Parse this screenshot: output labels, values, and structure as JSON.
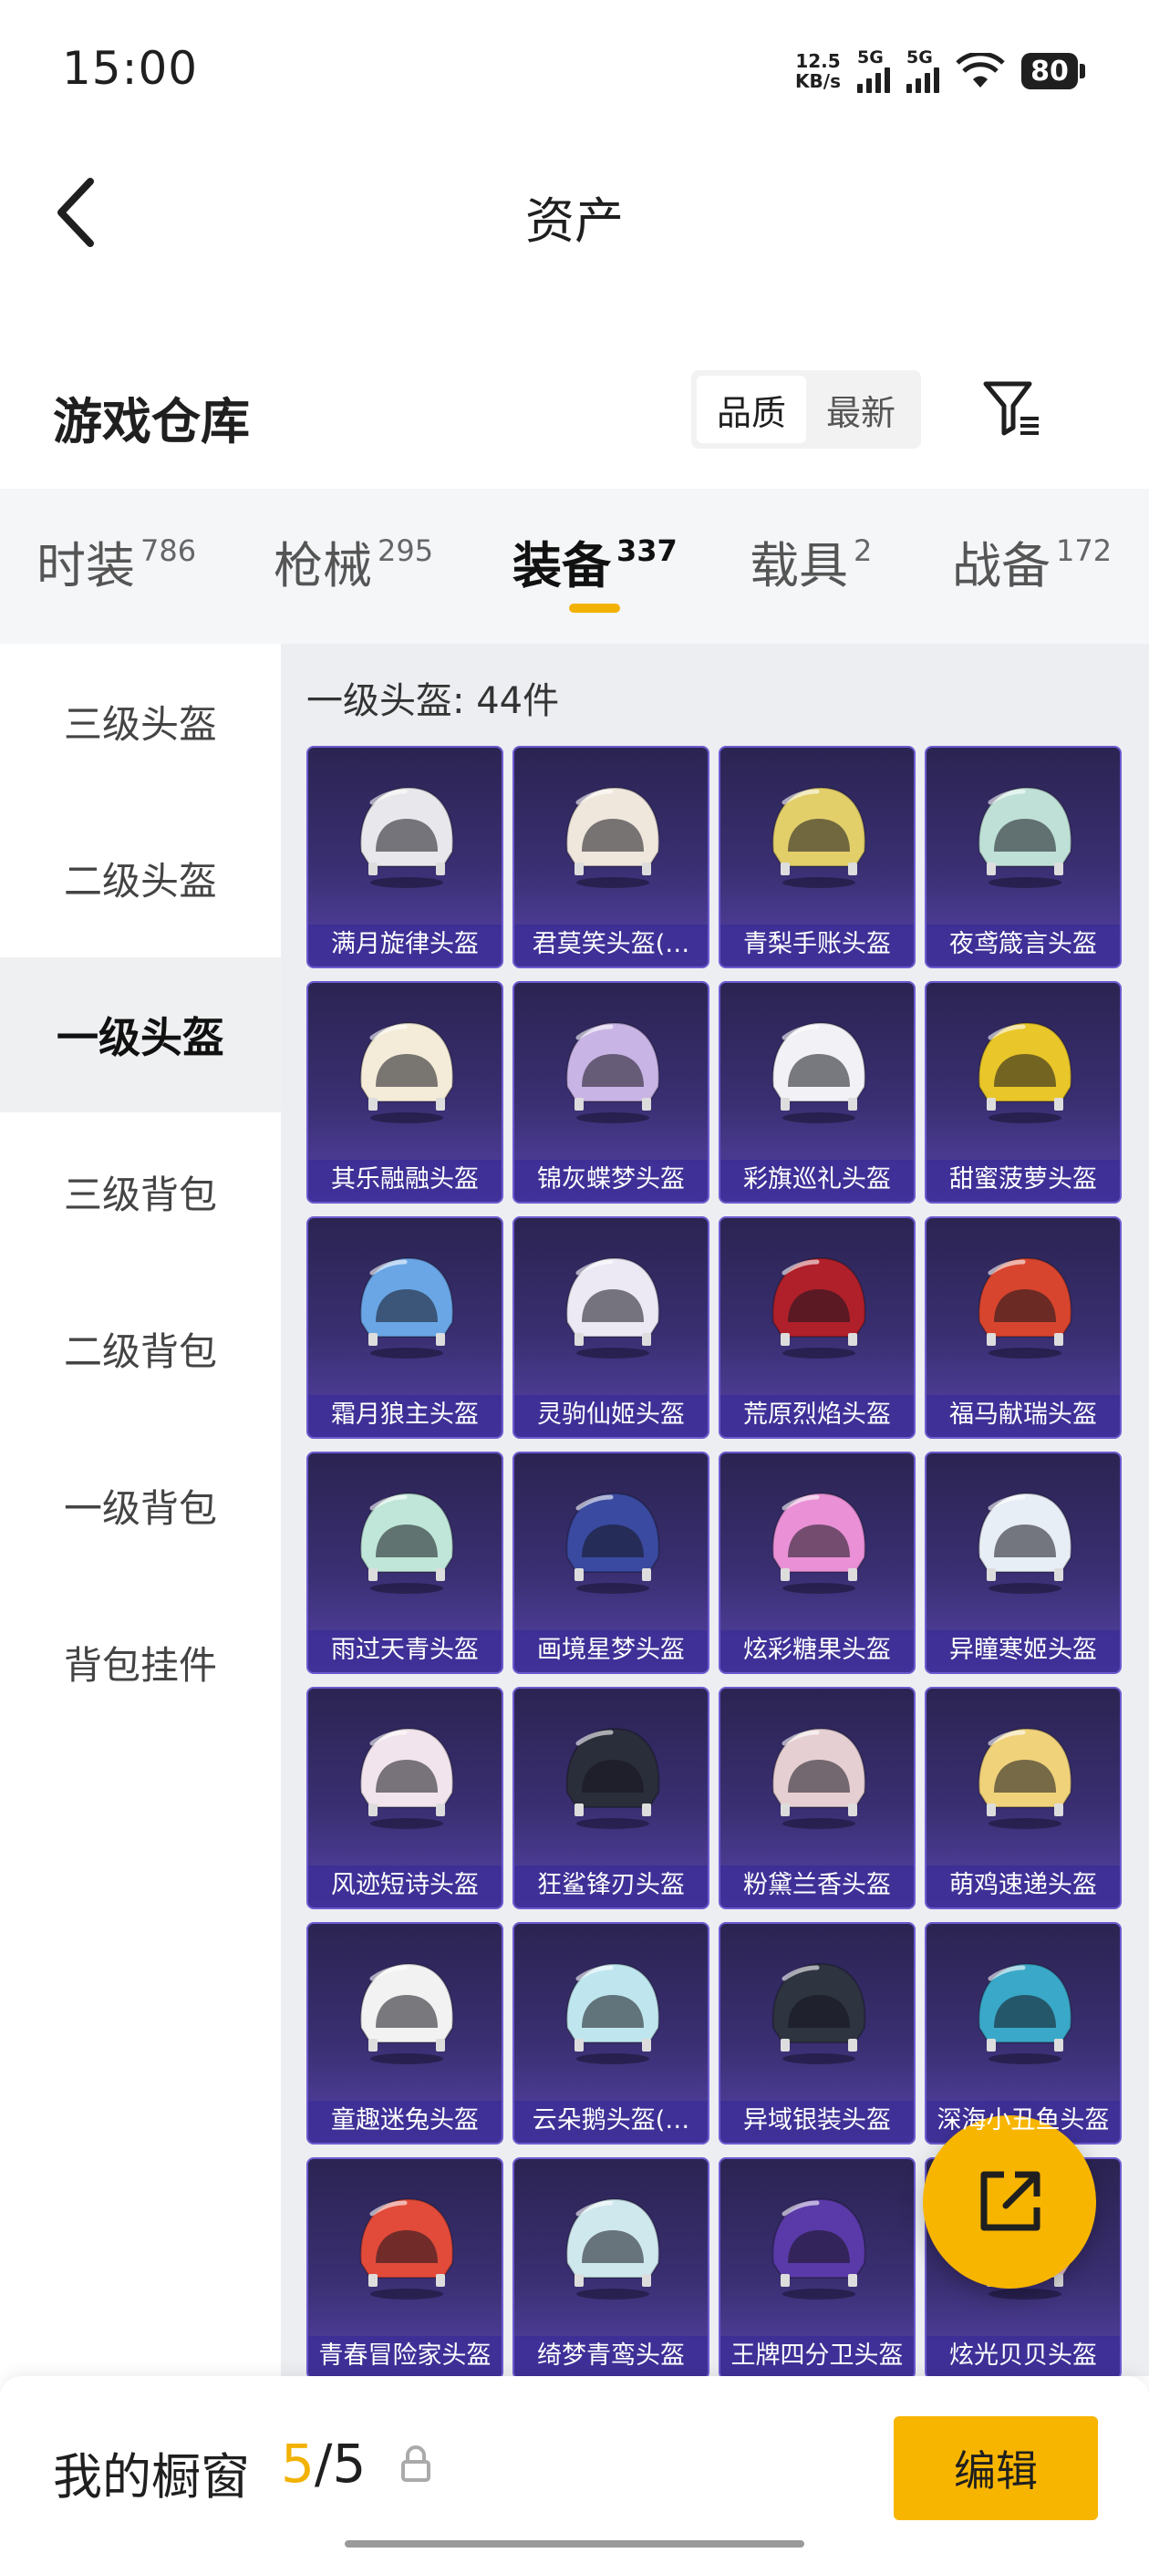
{
  "status": {
    "time": "15:00",
    "net_speed_value": "12.5",
    "net_speed_unit": "KB/s",
    "sim1_label": "5G",
    "sim2_label": "5G",
    "battery": "80"
  },
  "header": {
    "title": "资产"
  },
  "warehouse": {
    "title": "游戏仓库",
    "sort_options": [
      "品质",
      "最新"
    ],
    "sort_active": "品质"
  },
  "tabs": [
    {
      "label": "时装",
      "count": "786"
    },
    {
      "label": "枪械",
      "count": "295"
    },
    {
      "label": "装备",
      "count": "337"
    },
    {
      "label": "载具",
      "count": "2"
    },
    {
      "label": "战备",
      "count": "172"
    }
  ],
  "sidebar": {
    "items": [
      "三级头盔",
      "二级头盔",
      "一级头盔",
      "三级背包",
      "二级背包",
      "一级背包",
      "背包挂件"
    ],
    "active": "一级头盔"
  },
  "content": {
    "count_label": "一级头盔: 44件",
    "items": [
      {
        "name": "满月旋律头盔",
        "color": "#e8e8ec"
      },
      {
        "name": "君莫笑头盔(…",
        "color": "#efe6dc"
      },
      {
        "name": "青梨手账头盔",
        "color": "#e2cf6a"
      },
      {
        "name": "夜鸢箴言头盔",
        "color": "#bfe0d6"
      },
      {
        "name": "其乐融融头盔",
        "color": "#f4ecd8"
      },
      {
        "name": "锦灰蝶梦头盔",
        "color": "#c9b4e6"
      },
      {
        "name": "彩旗巡礼头盔",
        "color": "#f2f2f6"
      },
      {
        "name": "甜蜜菠萝头盔",
        "color": "#e9c629"
      },
      {
        "name": "霜月狼主头盔",
        "color": "#6aa6e6"
      },
      {
        "name": "灵驹仙姬头盔",
        "color": "#ece8f4"
      },
      {
        "name": "荒原烈焰头盔",
        "color": "#b0202a"
      },
      {
        "name": "福马献瑞头盔",
        "color": "#d8452e"
      },
      {
        "name": "雨过天青头盔",
        "color": "#bfe6d8"
      },
      {
        "name": "画境星梦头盔",
        "color": "#3a4aa0"
      },
      {
        "name": "炫彩糖果头盔",
        "color": "#e990d6"
      },
      {
        "name": "异瞳寒姬头盔",
        "color": "#e8eef6"
      },
      {
        "name": "风迹短诗头盔",
        "color": "#f2e4ec"
      },
      {
        "name": "狂鲨锋刃头盔",
        "color": "#2a2e3a"
      },
      {
        "name": "粉黛兰香头盔",
        "color": "#e6cfd2"
      },
      {
        "name": "萌鸡速递头盔",
        "color": "#f0d27a"
      },
      {
        "name": "童趣迷兔头盔",
        "color": "#f2f2f2"
      },
      {
        "name": "云朵鹅头盔(…",
        "color": "#bfe6ee"
      },
      {
        "name": "异域银装头盔",
        "color": "#2e3440"
      },
      {
        "name": "深海小丑鱼头盔",
        "color": "#3aa8c8"
      },
      {
        "name": "青春冒险家头盔",
        "color": "#e24a3a"
      },
      {
        "name": "绮梦青鸾头盔",
        "color": "#cfe8ee"
      },
      {
        "name": "王牌四分卫头盔",
        "color": "#5a3aa8"
      },
      {
        "name": "炫光贝贝头盔",
        "color": "#e8c0d8"
      }
    ]
  },
  "showcase": {
    "title": "我的橱窗",
    "current": "5",
    "total": "/5",
    "edit_label": "编辑"
  },
  "colors": {
    "accent": "#f7b500",
    "card_bg": "#3a2f72"
  }
}
